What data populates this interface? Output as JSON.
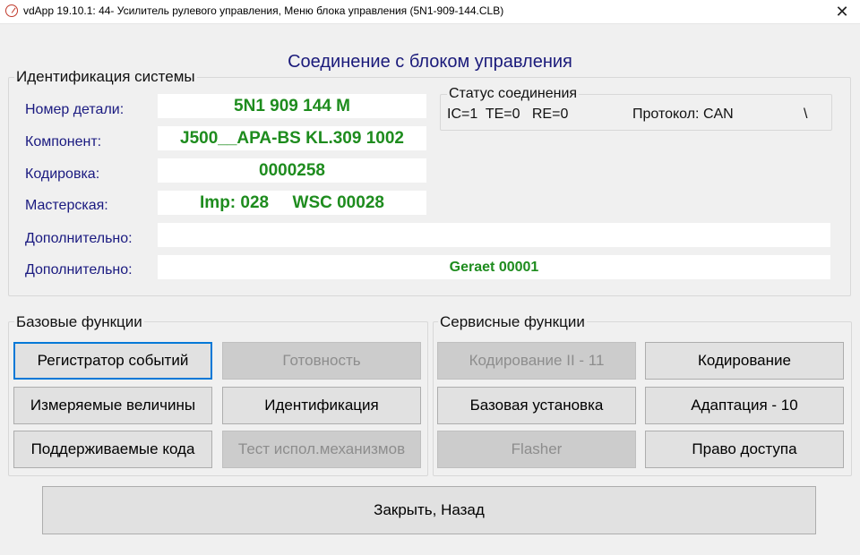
{
  "window": {
    "title": "vdApp 19.10.1: 44- Усилитель рулевого управления,  Меню блока управления (5N1-909-144.CLB)",
    "close_glyph": "✕"
  },
  "main_title": "Соединение с блоком управления",
  "identification": {
    "group_label": "Идентификация системы",
    "part_number_label": "Номер детали:",
    "part_number_value": "5N1 909 144 M",
    "component_label": "Компонент:",
    "component_value": "J500__APA-BS KL.309 1002",
    "coding_label": "Кодировка:",
    "coding_value": "0000258",
    "workshop_label": "Мастерская:",
    "workshop_value": "Imp: 028     WSC 00028",
    "extra1_label": "Дополнительно:",
    "extra1_value": "",
    "extra2_label": "Дополнительно:",
    "extra2_value": "Geraet 00001"
  },
  "connection_status": {
    "group_label": "Статус соединения",
    "counters": "IC=1  TE=0   RE=0",
    "protocol": "Протокол: CAN",
    "spinner": "\\"
  },
  "basic_functions": {
    "group_label": "Базовые функции",
    "event_recorder": "Регистратор событий",
    "readiness": "Готовность",
    "measured_values": "Измеряемые величины",
    "identification": "Идентификация",
    "supported_codes": "Поддерживаемые кода",
    "actuator_test": "Тест испол.механизмов"
  },
  "service_functions": {
    "group_label": "Сервисные функции",
    "coding_ii": "Кодирование II - 11",
    "coding": "Кодирование",
    "basic_setting": "Базовая установка",
    "adaptation": "Адаптация - 10",
    "flasher": "Flasher",
    "access_rights": "Право доступа"
  },
  "close_back": "Закрыть, Назад",
  "colors": {
    "title_blue": "#1a1a7a",
    "label_blue": "#1a1a80",
    "value_green": "#1e8c1e",
    "focus_blue": "#0078d7"
  }
}
